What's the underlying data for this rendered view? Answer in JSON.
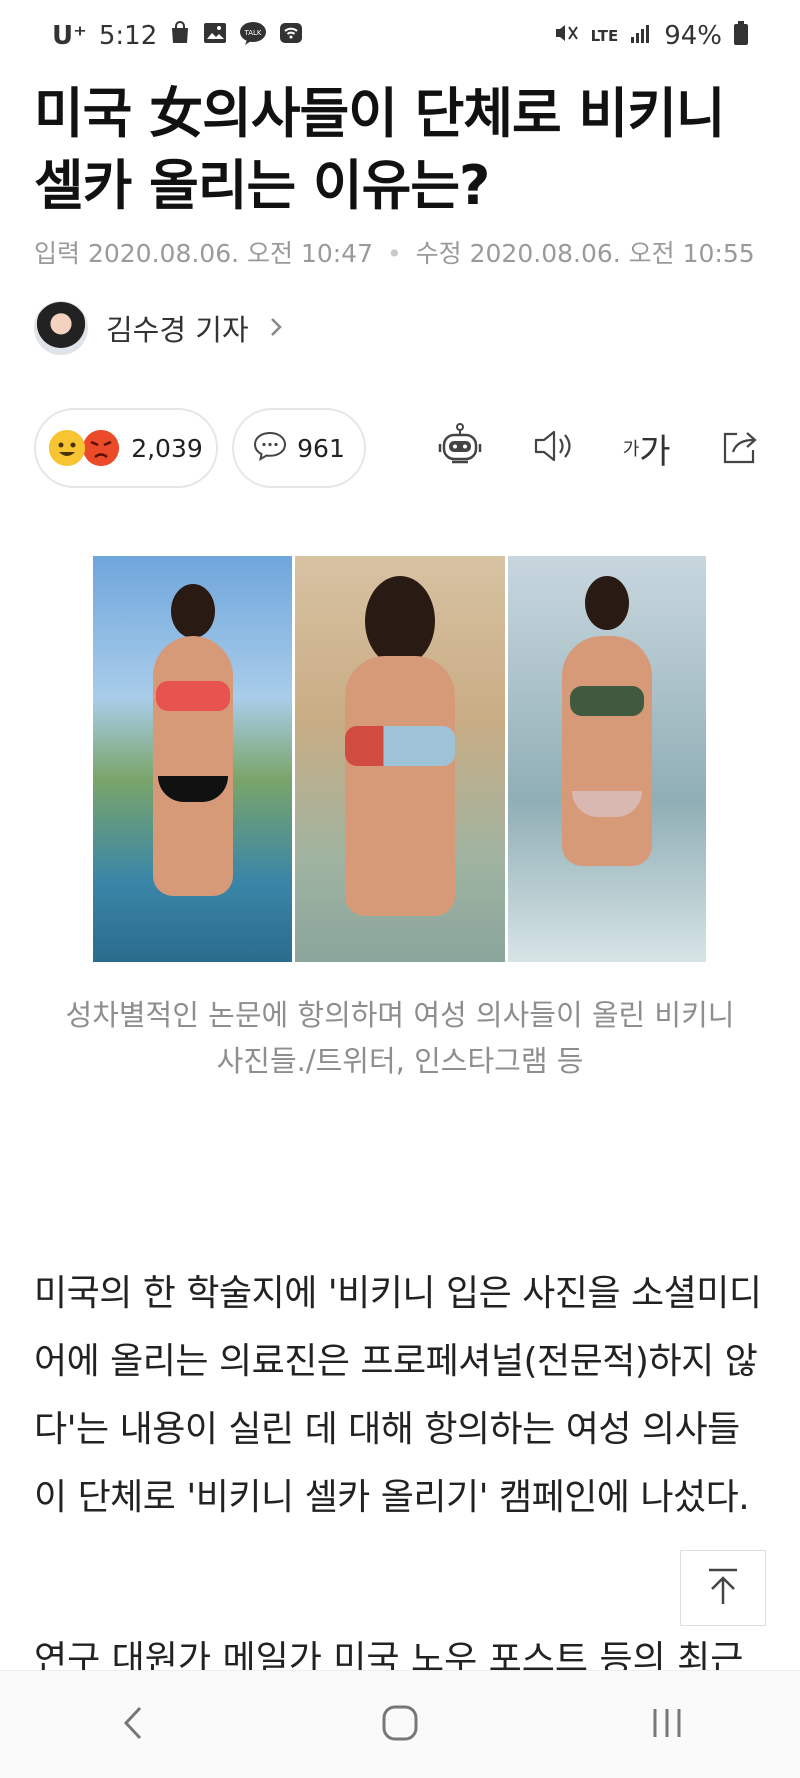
{
  "status_bar": {
    "carrier": "U⁺",
    "time": "5:12",
    "notification_icons": [
      "shopping-bag-icon",
      "gallery-icon",
      "talk-icon",
      "wifi-icon"
    ],
    "talk_label": "TALK",
    "lte_label": "LTE",
    "battery_percent": "94%"
  },
  "article": {
    "title": "미국 女의사들이 단체로 비키니 셀카 올리는 이유는?",
    "input_label": "입력",
    "input_datetime": "2020.08.06. 오전 10:47",
    "edit_label": "수정",
    "edit_datetime": "2020.08.06. 오전 10:55",
    "author": "김수경 기자"
  },
  "actions": {
    "reaction_count": "2,039",
    "comment_count": "961",
    "font_size_small": "가",
    "font_size_large": "가"
  },
  "image": {
    "caption": "성차별적인 논문에 항의하며 여성 의사들이 올린 비키니 사진들./트위터, 인스타그램 등"
  },
  "content": {
    "paragraph_1": "미국의 한 학술지에 '비키니 입은 사진을 소셜미디어에 올리는 의료진은 프로페셔널(전문적)하지 않다'는 내용이 실린 데 대해 항의하는 여성 의사들이 단체로 '비키니 셀카 올리기' 캠페인에 나섰다.",
    "paragraph_2_partial": "연구 대원가 메일가 미국 노우 포스트 등의 최근"
  },
  "colors": {
    "emoji_happy": "#f7c531",
    "emoji_angry": "#ec4b2a",
    "meta_gray": "#9a9a9a"
  }
}
